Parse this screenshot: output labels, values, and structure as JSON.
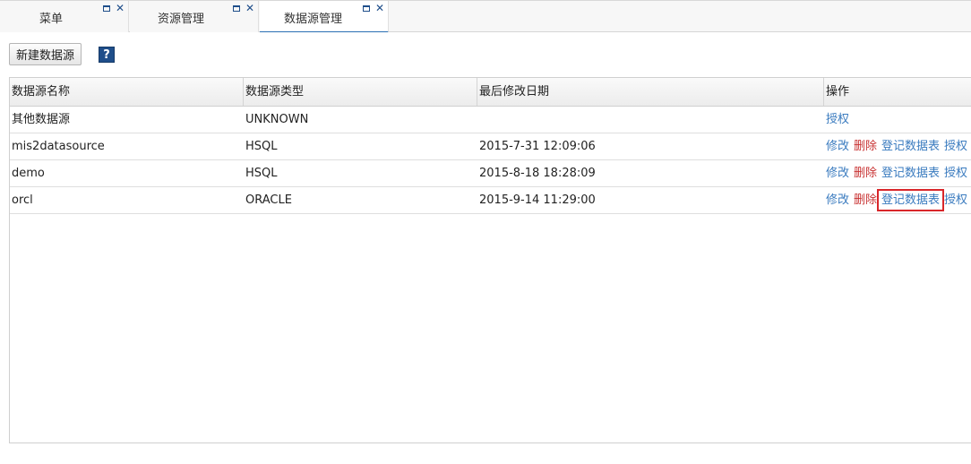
{
  "tabs": [
    {
      "label": "菜单",
      "active": false
    },
    {
      "label": "资源管理",
      "active": false
    },
    {
      "label": "数据源管理",
      "active": true
    }
  ],
  "toolbar": {
    "new_button_label": "新建数据源",
    "help_glyph": "?"
  },
  "table": {
    "headers": [
      "数据源名称",
      "数据源类型",
      "最后修改日期",
      "操作"
    ],
    "rows": [
      {
        "name": "其他数据源",
        "type": "UNKNOWN",
        "modified": "",
        "actions": [
          "授权"
        ]
      },
      {
        "name": "mis2datasource",
        "type": "HSQL",
        "modified": "2015-7-31 12:09:06",
        "actions": [
          "修改",
          "删除",
          "登记数据表",
          "授权"
        ]
      },
      {
        "name": "demo",
        "type": "HSQL",
        "modified": "2015-8-18 18:28:09",
        "actions": [
          "修改",
          "删除",
          "登记数据表",
          "授权"
        ]
      },
      {
        "name": "orcl",
        "type": "ORACLE",
        "modified": "2015-9-14 11:29:00",
        "actions": [
          "修改",
          "删除",
          "登记数据表",
          "授权"
        ]
      }
    ]
  },
  "colors": {
    "link": "#3a7bbf",
    "delete_link": "#c83232",
    "highlight": "#d9262a",
    "active_tab_underline": "#2a6fb3"
  }
}
